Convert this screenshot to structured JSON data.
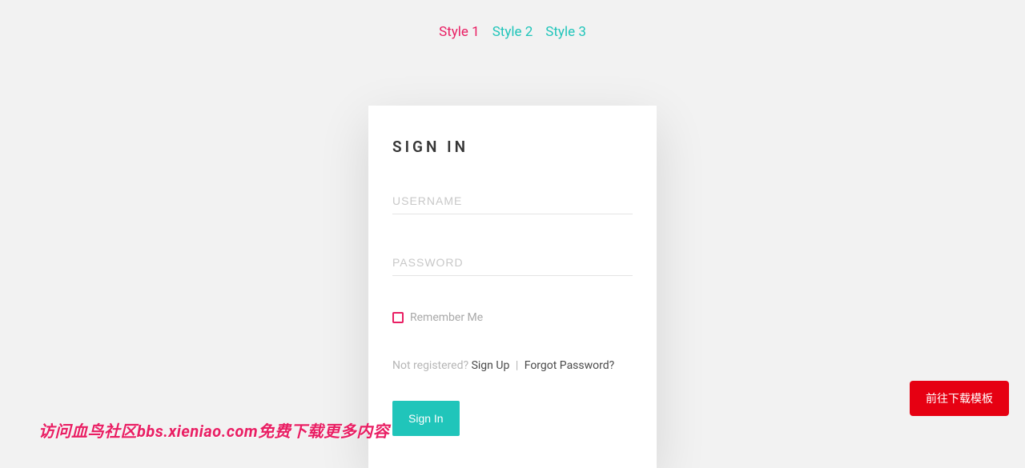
{
  "nav": {
    "items": [
      {
        "label": "Style 1",
        "active": true
      },
      {
        "label": "Style 2",
        "active": false
      },
      {
        "label": "Style 3",
        "active": false
      }
    ]
  },
  "card": {
    "title": "SIGN IN",
    "username_placeholder": "USERNAME",
    "password_placeholder": "PASSWORD",
    "remember_label": "Remember Me",
    "not_registered": "Not registered?",
    "signup_label": "Sign Up",
    "separator": "|",
    "forgot_label": "Forgot Password?",
    "submit_label": "Sign In"
  },
  "download_button": "前往下载模板",
  "watermark": "访问血鸟社区bbs.xieniao.com免费下载更多内容"
}
